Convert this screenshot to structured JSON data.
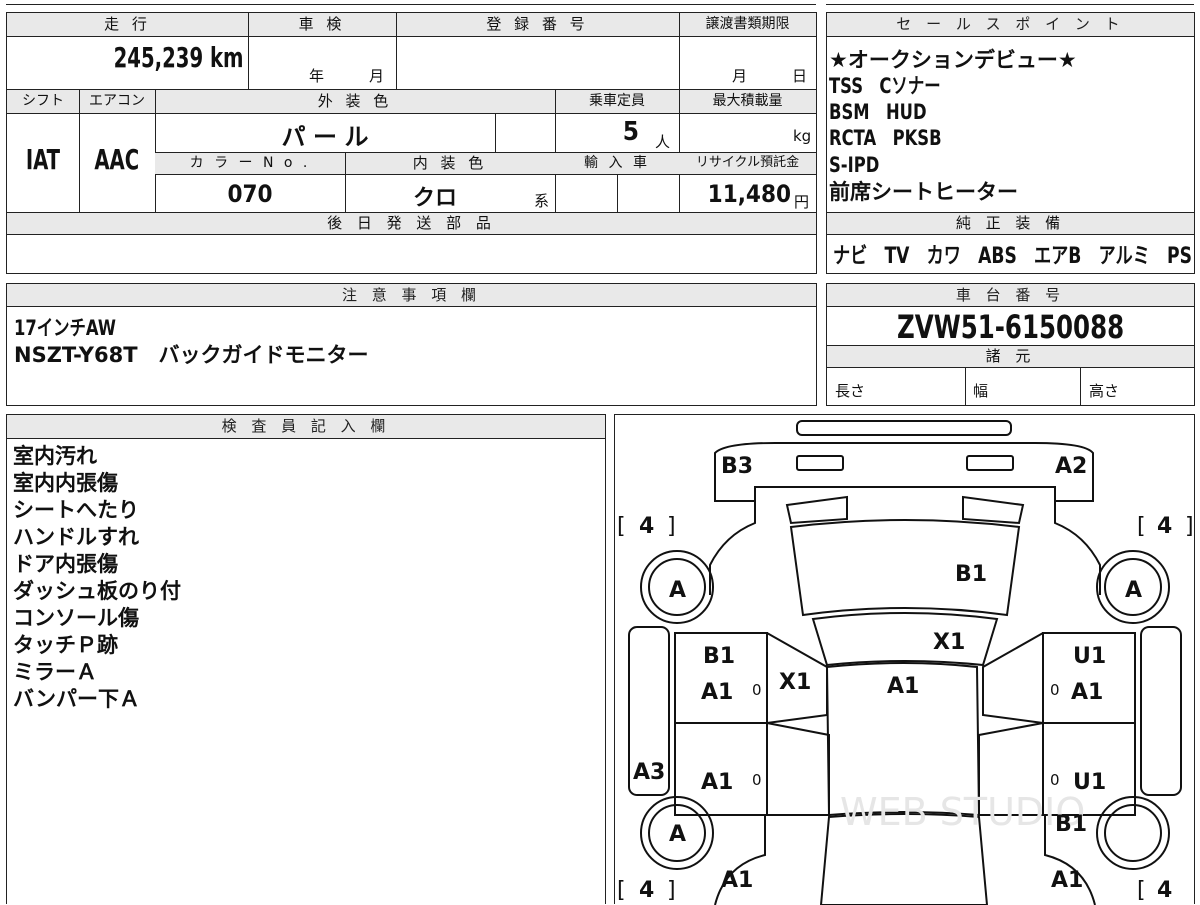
{
  "top_row": {
    "soko_label": "走 行",
    "shaken_label": "車 検",
    "toroku_label": "登 録 番 号",
    "joto_label": "譲渡書類期限",
    "mileage": "245,239 km",
    "year_unit": "年",
    "month_unit": "月",
    "joto_month": "月",
    "joto_day": "日"
  },
  "second_row": {
    "shift_label": "シフト",
    "aircon_label": "エアコン",
    "gaiso_label": "外 装 色",
    "teiin_label": "乗車定員",
    "saidai_label": "最大積載量",
    "shift_value": "IAT",
    "aircon_value": "AAC",
    "gaiso_value": "パ ー ル",
    "teiin_value": "5",
    "teiin_unit": "人",
    "saidai_unit": "kg"
  },
  "third_row": {
    "color_no_label": "カ ラ ー N o .",
    "naiso_label": "内 装 色",
    "yunyu_label": "輸 入 車",
    "recycle_label": "リサイクル預託金",
    "color_no": "070",
    "naiso_value": "クロ",
    "naiso_suffix": "系",
    "recycle_value": "11,480",
    "recycle_unit": "円"
  },
  "gojitsu": {
    "label": "後 日 発 送 部 品"
  },
  "sales_point": {
    "label": "セ ー ル ス ポ イ ン ト",
    "lines": [
      "★オークションデビュー★",
      "TSS　Cソナー",
      "BSM　HUD",
      "RCTA　PKSB",
      "S-IPD",
      "前席シートヒーター"
    ]
  },
  "junsei": {
    "label": "純 正 装 備",
    "items": "ナビ　TV　カワ　ABS　エアB　アルミ　PS　PW"
  },
  "chui": {
    "label": "注 意 事 項 欄",
    "lines": [
      "17インチAW",
      "NSZT-Y68T　バックガイドモニター"
    ]
  },
  "shadai": {
    "label": "車 台 番 号",
    "number": "ZVW51-6150088"
  },
  "shogen": {
    "label": "諸 元",
    "length_label": "長さ",
    "width_label": "幅",
    "height_label": "高さ"
  },
  "kensa": {
    "label": "検 査 員 記 入 欄",
    "lines": [
      "室内汚れ",
      "室内内張傷",
      "シートへたり",
      "ハンドルすれ",
      "ドア内張傷",
      "ダッシュ板のり付",
      "コンソール傷",
      "タッチＰ跡",
      "ミラーＡ",
      "バンパー下Ａ"
    ]
  },
  "diagram": {
    "codes": {
      "rear_left": "B3",
      "rear_right": "A2",
      "rear_glass": "B1",
      "roof_rear": "X1",
      "roof": "A1",
      "rear_door_left_top": "B1",
      "rear_door_left_bottom": "A1",
      "rear_door_left_mark": "X1",
      "rear_door_right_top": "U1",
      "rear_door_right_bottom": "A1",
      "front_door_left": "A1",
      "front_door_right": "U1",
      "rocker_left": "A3",
      "fender_right": "B1",
      "front_left": "A1",
      "front_right": "A1",
      "tire_rl": "A",
      "tire_rr": "A",
      "tire_fl": "A",
      "tread_rl": "4",
      "tread_rr": "4",
      "tread_fl": "4",
      "tread_fr": "4",
      "zero_mark": "0"
    },
    "watermark": "WEB STUDIO"
  }
}
